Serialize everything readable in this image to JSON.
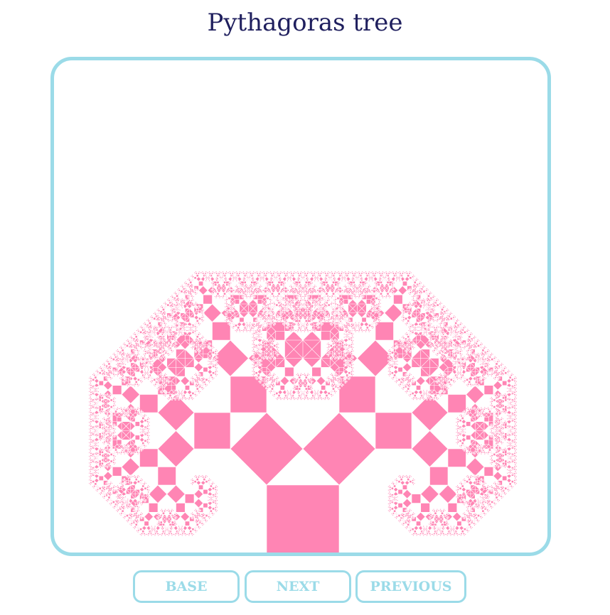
{
  "page": {
    "title": "Pythagoras tree"
  },
  "tree": {
    "fill_color": "#ff85b4",
    "depth": 12
  },
  "buttons": {
    "base": "BASE",
    "next": "NEXT",
    "previous": "PREVIOUS"
  },
  "colors": {
    "accent": "#9bdbe8",
    "title": "#1f1f5e"
  }
}
